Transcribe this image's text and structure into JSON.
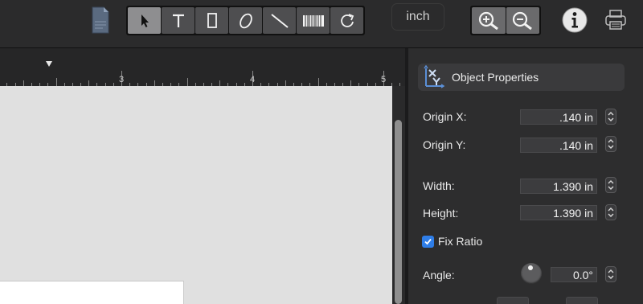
{
  "toolbar": {
    "document_icon": "document-icon",
    "tools": [
      {
        "name": "select",
        "icon": "arrow-pointer-icon",
        "active": true
      },
      {
        "name": "text",
        "icon": "text-icon",
        "active": false
      },
      {
        "name": "rectangle",
        "icon": "rectangle-icon",
        "active": false
      },
      {
        "name": "ellipse",
        "icon": "ellipse-icon",
        "active": false
      },
      {
        "name": "line",
        "icon": "line-icon",
        "active": false
      },
      {
        "name": "barcode",
        "icon": "barcode-icon",
        "active": false
      },
      {
        "name": "rotate",
        "icon": "rotate-icon",
        "active": false
      }
    ],
    "unit": "inch",
    "zoom_in_icon": "zoom-in-icon",
    "zoom_out_icon": "zoom-out-icon",
    "info_icon": "info-icon",
    "print_icon": "printer-icon"
  },
  "ruler": {
    "labels": [
      "3",
      "4",
      "5"
    ]
  },
  "panel": {
    "title": "Object Properties",
    "origin_x": {
      "label": "Origin X:",
      "value": ".140 in"
    },
    "origin_y": {
      "label": "Origin Y:",
      "value": ".140 in"
    },
    "width": {
      "label": "Width:",
      "value": "1.390 in"
    },
    "height": {
      "label": "Height:",
      "value": "1.390 in"
    },
    "fix_ratio": {
      "label": "Fix Ratio",
      "checked": true
    },
    "angle": {
      "label": "Angle:",
      "value": "0.0°"
    }
  },
  "colors": {
    "accent": "#2f7ee8",
    "toolbar_bg": "#2b2b2c",
    "panel_bg": "#2d2d2e",
    "canvas_bg": "#e0e0e0"
  }
}
